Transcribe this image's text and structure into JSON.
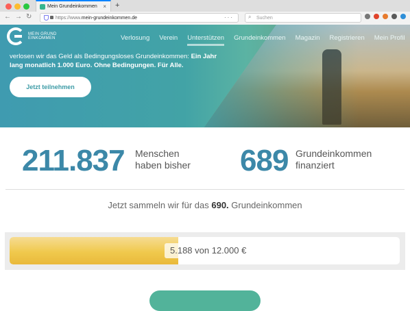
{
  "browser": {
    "tab_title": "Mein Grundeinkommen",
    "tab_close": "×",
    "new_tab": "+",
    "url_prefix": "https://www.",
    "url_domain": "mein-grundeinkommen.de",
    "url_actions": "···",
    "search_placeholder": "Suchen",
    "back": "←",
    "forward": "→",
    "reload": "↻",
    "menu": "≡"
  },
  "logo": {
    "line1": "MEIN GRUND",
    "line2": "EINKOMMEN"
  },
  "nav": {
    "items": [
      {
        "label": "Verlosung"
      },
      {
        "label": "Verein"
      },
      {
        "label": "Unterstützen"
      },
      {
        "label": "Grundeinkommen"
      },
      {
        "label": "Magazin"
      },
      {
        "label": "Registrieren"
      },
      {
        "label": "Mein Profil"
      }
    ],
    "active_index": 2
  },
  "hero": {
    "text_regular": "verlosen wir das Geld als Bedingungsloses Grundeinkommen: ",
    "text_bold": "Ein Jahr lang monatlich 1.000 Euro. Ohne Bedingungen. Für Alle.",
    "cta_label": "Jetzt teilnehmen"
  },
  "stats": {
    "people_count": "211.837",
    "people_label_1": "Menschen",
    "people_label_2": "haben bisher",
    "funded_count": "689",
    "funded_label_1": "Grundeinkommen",
    "funded_label_2": "finanziert"
  },
  "collect": {
    "prefix": "Jetzt sammeln wir für das ",
    "number": "690.",
    "suffix": " Grundeinkommen"
  },
  "progress": {
    "label": "5.188 von 12.000 €",
    "fraction": 0.432
  },
  "colors": {
    "accent": "#3c88a8",
    "teal": "#42a3a6",
    "progress_gold": "#f0c94d"
  }
}
